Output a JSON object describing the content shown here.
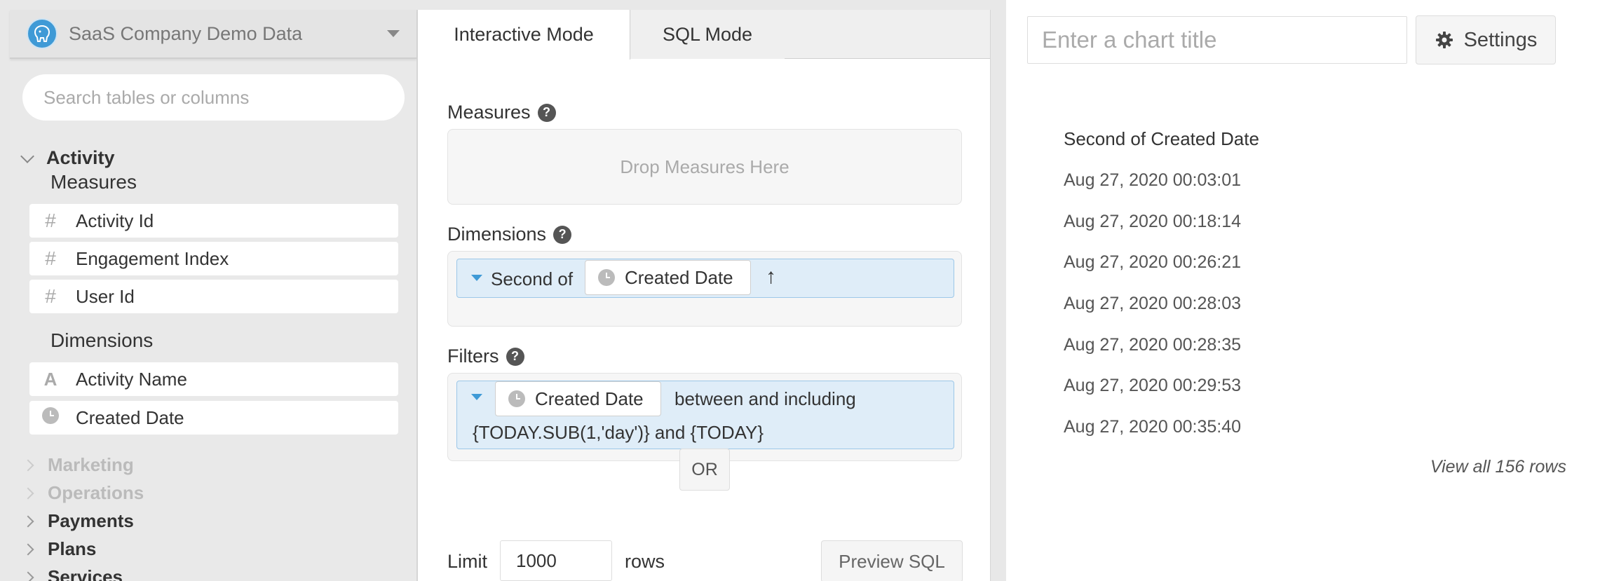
{
  "sidebar": {
    "datasource_name": "SaaS Company Demo Data",
    "search_placeholder": "Search tables or columns",
    "activity": {
      "label": "Activity",
      "measures_label": "Measures",
      "measures": [
        {
          "icon": "#",
          "label": "Activity Id"
        },
        {
          "icon": "#",
          "label": "Engagement Index"
        },
        {
          "icon": "#",
          "label": "User Id"
        }
      ],
      "dimensions_label": "Dimensions",
      "dimensions": [
        {
          "icon": "A",
          "label": "Activity Name"
        },
        {
          "icon": "clock",
          "label": "Created Date"
        }
      ]
    },
    "other_groups": [
      {
        "label": "Marketing",
        "state": "disabled"
      },
      {
        "label": "Operations",
        "state": "disabled"
      },
      {
        "label": "Payments",
        "state": "enabled"
      },
      {
        "label": "Plans",
        "state": "enabled"
      },
      {
        "label": "Services",
        "state": "enabled"
      }
    ]
  },
  "middle": {
    "tabs": [
      {
        "label": "Interactive Mode",
        "active": true
      },
      {
        "label": "SQL Mode",
        "active": false
      }
    ],
    "measures_label": "Measures",
    "measures_drop_text": "Drop Measures Here",
    "dimensions_label": "Dimensions",
    "dimension_pill": {
      "prefix": "Second of",
      "field": "Created Date",
      "sort_icon": "↑"
    },
    "filters_label": "Filters",
    "filter_pill": {
      "field": "Created Date",
      "operator": "between and including",
      "value": "{TODAY.SUB(1,'day')} and {TODAY}"
    },
    "or_label": "OR",
    "limit_label": "Limit",
    "limit_value": "1000",
    "rows_label": "rows",
    "preview_sql_label": "Preview SQL"
  },
  "right": {
    "title_placeholder": "Enter a chart title",
    "settings_label": "Settings",
    "column_header": "Second of Created Date",
    "rows": [
      "Aug 27, 2020 00:03:01",
      "Aug 27, 2020 00:18:14",
      "Aug 27, 2020 00:26:21",
      "Aug 27, 2020 00:28:03",
      "Aug 27, 2020 00:28:35",
      "Aug 27, 2020 00:29:53",
      "Aug 27, 2020 00:35:40"
    ],
    "view_all_label": "View all 156 rows"
  },
  "colors": {
    "accent": "#3f9ad6",
    "pill_bg": "#dfedf8",
    "pill_border": "#9cc7e8",
    "sidebar_bg": "#e9e9e9"
  }
}
